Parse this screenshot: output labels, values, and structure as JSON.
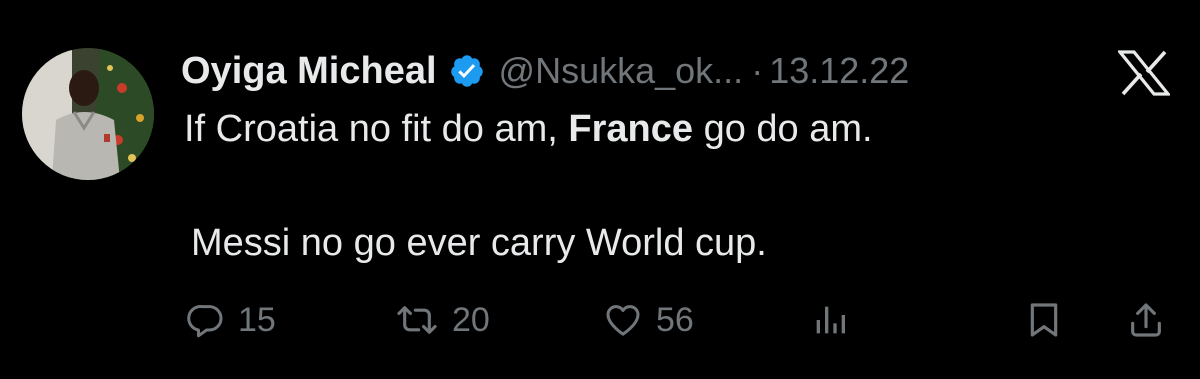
{
  "tweet": {
    "display_name": "Oyiga Micheal",
    "handle": "@Nsukka_ok...",
    "separator": "·",
    "date": "13.12.22",
    "text_line1_part1": "If Croatia no fit do am, ",
    "text_line1_bold": "France",
    "text_line1_part2": " go do am.",
    "text_line2": "Messi no go ever carry World cup."
  },
  "actions": {
    "replies": "15",
    "retweets": "20",
    "likes": "56"
  },
  "icons": {
    "verified": "verified-badge-icon",
    "brand": "x-logo-icon",
    "reply": "reply-icon",
    "retweet": "retweet-icon",
    "like": "heart-icon",
    "views": "analytics-icon",
    "bookmark": "bookmark-icon",
    "share": "share-icon"
  },
  "colors": {
    "background": "#000000",
    "text": "#e7e9ea",
    "secondary": "#71767b",
    "verified": "#1d9bf0"
  }
}
